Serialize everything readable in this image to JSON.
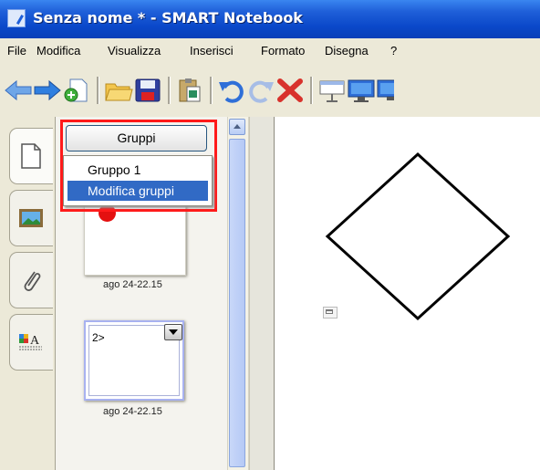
{
  "window": {
    "title": "Senza nome * - SMART Notebook"
  },
  "menu": {
    "items": [
      "File",
      "Modifica",
      "Visualizza",
      "Inserisci",
      "Formato",
      "Disegna",
      "?"
    ]
  },
  "toolbar": {
    "buttons": [
      "back-arrow-icon",
      "forward-arrow-icon",
      "add-page-icon",
      "open-folder-icon",
      "save-icon",
      "paste-icon",
      "undo-icon",
      "redo-icon",
      "delete-icon",
      "screen-shade-icon",
      "display-icon",
      "display-icon-2"
    ]
  },
  "sidebar": {
    "tabs": [
      "page-sorter-icon",
      "gallery-icon",
      "attachments-icon",
      "properties-icon"
    ],
    "groups_button": "Gruppi",
    "groups_menu": {
      "items": [
        "Gruppo 1",
        "Modifica gruppi"
      ],
      "selected_index": 1
    },
    "pages": [
      {
        "caption": "ago 24-22.15"
      },
      {
        "number": "2>",
        "caption": "ago 24-22.15"
      }
    ]
  },
  "colors": {
    "title_bar": "#0a48c9",
    "highlight_box": "#ff1a1a",
    "menu_selection": "#316ac5",
    "page_dot": "#e41010"
  }
}
